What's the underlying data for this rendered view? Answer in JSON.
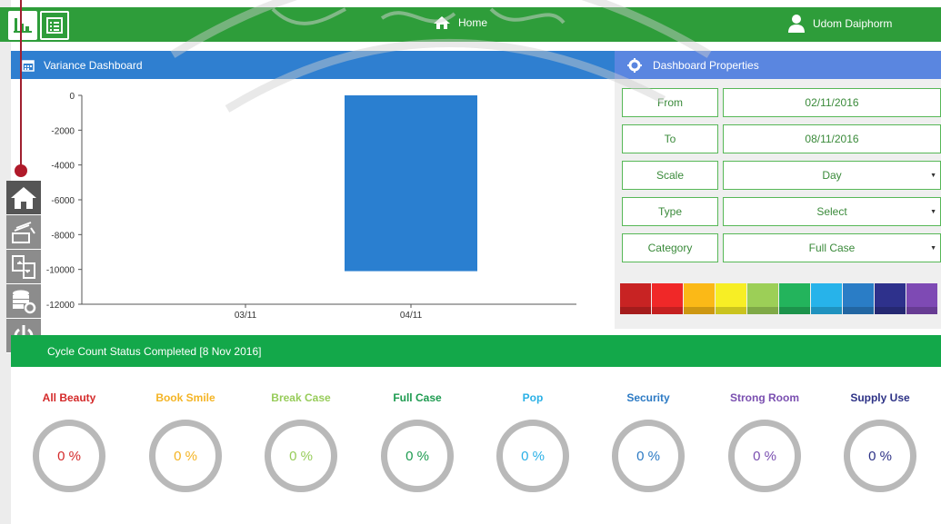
{
  "topbar": {
    "home_label": "Home",
    "user_name": "Udom Daiphorm",
    "icons": [
      "bar-chart-icon",
      "list-icon",
      "home-icon",
      "user-icon"
    ]
  },
  "variance": {
    "title": "Variance Dashboard"
  },
  "chart_data": {
    "type": "bar",
    "categories": [
      "03/11",
      "04/11"
    ],
    "values": [
      0,
      -10100
    ],
    "ylim": [
      -12000,
      0
    ],
    "yticks": [
      0,
      -2000,
      -4000,
      -6000,
      -8000,
      -10000,
      -12000
    ],
    "ytick_labels": [
      "0",
      "-2000",
      "-4000",
      "-6000",
      "-8000",
      "-10000",
      "-12000"
    ],
    "title": "",
    "xlabel": "",
    "ylabel": "",
    "bar_color": "#2a7fd0",
    "grid": false
  },
  "properties": {
    "title": "Dashboard Properties",
    "rows": [
      {
        "label": "From",
        "value": "02/11/2016",
        "dropdown": false
      },
      {
        "label": "To",
        "value": "08/11/2016",
        "dropdown": false
      },
      {
        "label": "Scale",
        "value": "Day",
        "dropdown": true
      },
      {
        "label": "Type",
        "value": "Select",
        "dropdown": true
      },
      {
        "label": "Category",
        "value": "Full Case",
        "dropdown": true
      }
    ],
    "palette": [
      "#c82323",
      "#f02828",
      "#fbb917",
      "#f7ee25",
      "#9ccf57",
      "#23b45c",
      "#27b3ea",
      "#2a7dc6",
      "#2e318c",
      "#7e4ab4"
    ]
  },
  "side_toolbar": {
    "buttons": [
      "home-icon",
      "stack-icon",
      "transfer-icon",
      "database-settings-icon",
      "power-icon"
    ]
  },
  "cycle": {
    "title": "Cycle Count Status Completed [8 Nov 2016]",
    "items": [
      {
        "name": "All Beauty",
        "value": "0 %",
        "color": "#d42a2a"
      },
      {
        "name": "Book Smile",
        "value": "0 %",
        "color": "#f4b424"
      },
      {
        "name": "Break Case",
        "value": "0 %",
        "color": "#97cc5a"
      },
      {
        "name": "Full Case",
        "value": "0 %",
        "color": "#1e9b50"
      },
      {
        "name": "Pop",
        "value": "0 %",
        "color": "#2ab0e6"
      },
      {
        "name": "Security",
        "value": "0 %",
        "color": "#2c7ac4"
      },
      {
        "name": "Strong Room",
        "value": "0 %",
        "color": "#7a4fb0"
      },
      {
        "name": "Supply Use",
        "value": "0 %",
        "color": "#2d3286"
      }
    ]
  }
}
